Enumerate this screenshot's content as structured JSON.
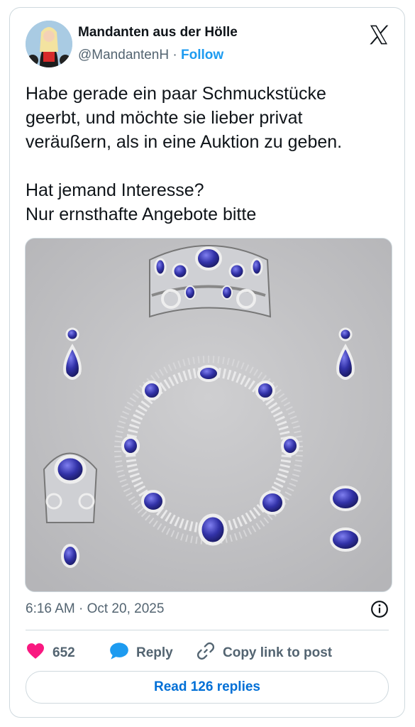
{
  "author": {
    "display_name": "Mandanten aus der Hölle",
    "handle": "@MandantenH",
    "separator": "·",
    "follow_label": "Follow"
  },
  "post": {
    "lines_p1": [
      "Habe gerade ein paar Schmuckstücke",
      "geerbt, und möchte sie lieber privat",
      "veräußern, als in eine Auktion zu geben."
    ],
    "lines_p2": [
      "Hat jemand Interesse?",
      "Nur ernsthafte Angebote bitte"
    ],
    "timestamp": "6:16 AM · Oct 20, 2025"
  },
  "actions": {
    "like_count": "652",
    "reply_label": "Reply",
    "copy_link_label": "Copy link to post",
    "read_replies_label": "Read 126 replies"
  },
  "colors": {
    "like": "#f91880",
    "reply": "#1d9bf0",
    "link": "#006fd6",
    "muted": "#536471"
  },
  "icons": [
    "x-logo-icon",
    "info-icon",
    "heart-icon",
    "reply-bubble-icon",
    "link-icon"
  ]
}
